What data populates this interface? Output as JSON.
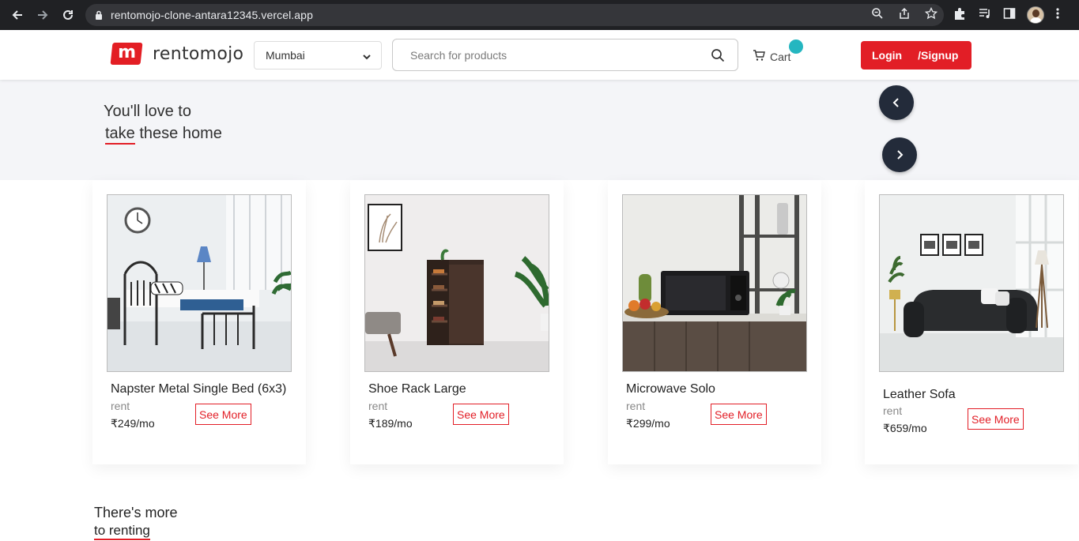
{
  "browser": {
    "url": "rentomojo-clone-antara12345.vercel.app"
  },
  "header": {
    "logo_text": "rentomojo",
    "logo_mark": "m",
    "city": "Mumbai",
    "search_placeholder": "Search for products",
    "cart_label": "Cart",
    "login_label": "Login",
    "signup_label": "/Signup"
  },
  "hero": {
    "title_line1": "You'll love to",
    "title_underlined": "take",
    "title_rest": " these home"
  },
  "products": [
    {
      "name": "Napster Metal Single Bed (6x3)",
      "rent_label": "rent",
      "price": "₹249/mo",
      "button": "See More"
    },
    {
      "name": "Shoe Rack Large",
      "rent_label": "rent",
      "price": "₹189/mo",
      "button": "See More"
    },
    {
      "name": "Microwave Solo",
      "rent_label": "rent",
      "price": "₹299/mo",
      "button": "See More"
    },
    {
      "name": "Leather Sofa",
      "rent_label": "rent",
      "price": "₹659/mo",
      "button": "See More"
    }
  ],
  "more": {
    "line1": "There's more",
    "line2": "to renting"
  },
  "colors": {
    "brand_red": "#e21e26",
    "cart_badge": "#25b6c0",
    "arrow_bg": "#232b3a",
    "hero_bg": "#f4f5f8"
  }
}
